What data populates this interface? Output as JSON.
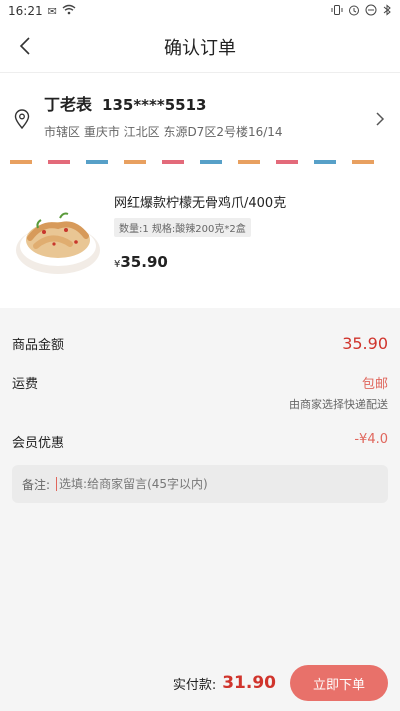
{
  "status_bar": {
    "time": "16:21",
    "icons": [
      "notification-icon",
      "wifi-icon",
      "vibrate-icon",
      "alarm-icon",
      "dnd-icon",
      "bluetooth-icon"
    ]
  },
  "nav": {
    "title": "确认订单",
    "back_icon": "chevron-left-icon"
  },
  "address": {
    "name": "丁老表",
    "phone": "135****5513",
    "detail": "市辖区 重庆市 江北区 东源D7区2号楼16/14",
    "pin_icon": "location-pin-icon",
    "chevron_icon": "chevron-right-icon"
  },
  "stripe_colors": [
    "#e8a060",
    "#e36a7a",
    "#57a0c8"
  ],
  "product": {
    "title": "网红爆款柠檬无骨鸡爪/400克",
    "spec": "数量:1 规格:酸辣200克*2盒",
    "currency": "¥",
    "price": "35.90"
  },
  "summary": {
    "goods_label": "商品金额",
    "goods_value": "35.90",
    "shipping_label": "运费",
    "shipping_value": "包邮",
    "shipping_note": "由商家选择快递配送",
    "member_label": "会员优惠",
    "member_value": "-¥4.0"
  },
  "remark": {
    "label": "备注:",
    "placeholder": "选填:给商家留言(45字以内)"
  },
  "footer": {
    "pay_label": "实付款:",
    "pay_amount": "31.90",
    "submit_label": "立即下单"
  },
  "colors": {
    "accent": "#d0342c",
    "button": "#e8716a"
  }
}
